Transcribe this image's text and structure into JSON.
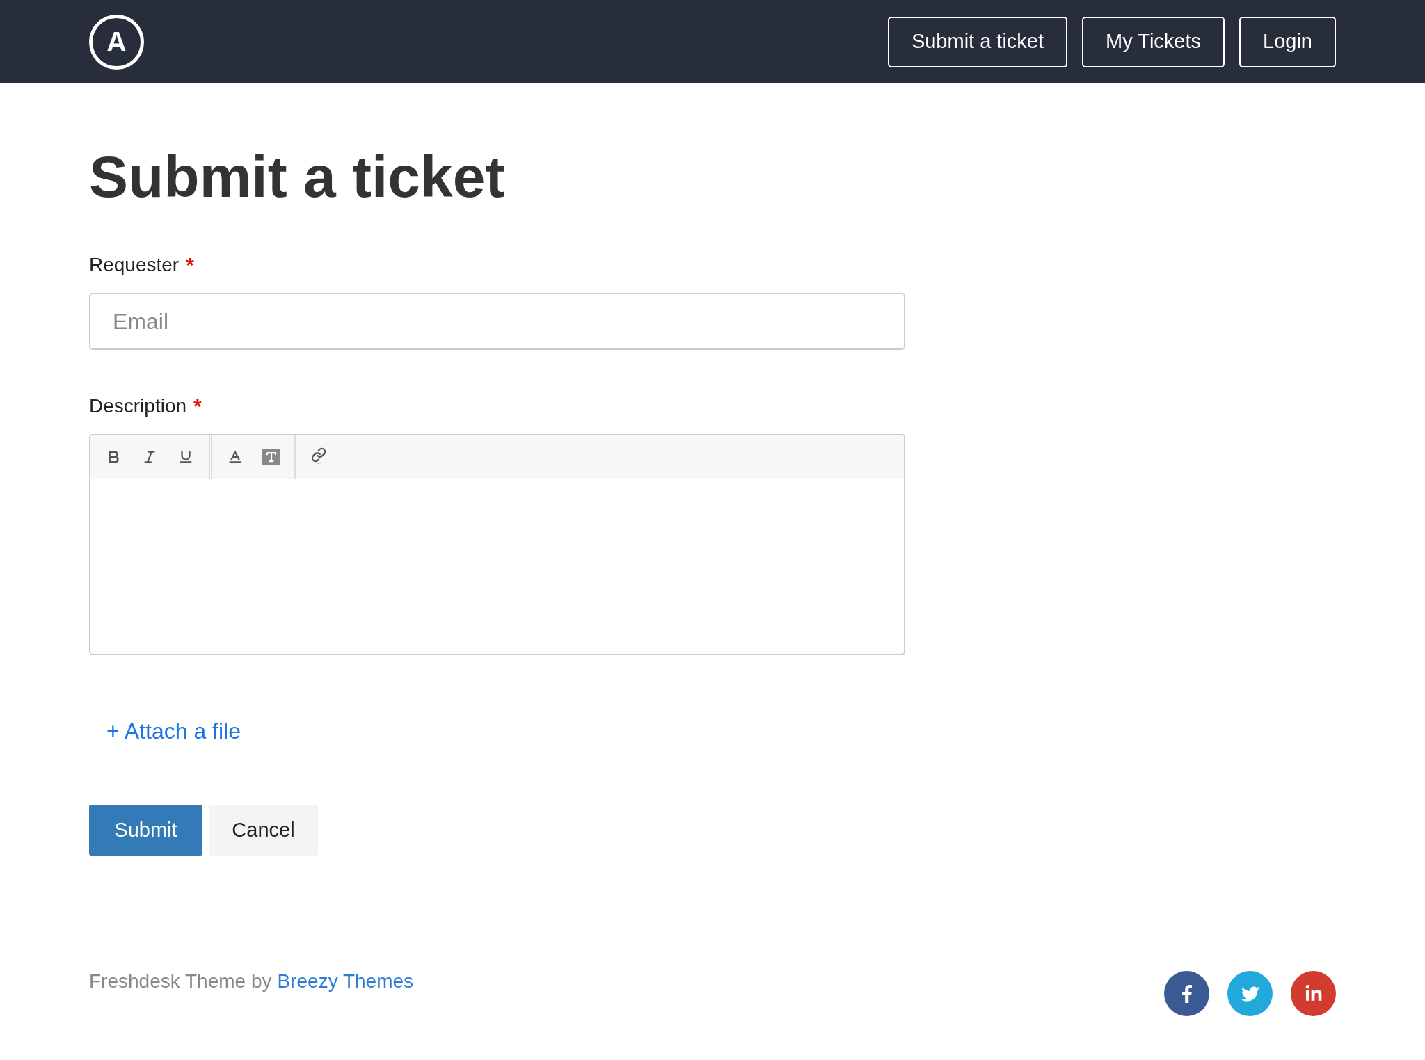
{
  "header": {
    "logo_letter": "A",
    "nav": [
      "Submit a ticket",
      "My Tickets",
      "Login"
    ]
  },
  "title": "Submit a ticket",
  "requester": {
    "label": "Requester",
    "required_mark": "*",
    "placeholder": "Email"
  },
  "description": {
    "label": "Description",
    "required_mark": "*",
    "toolbar": [
      {
        "buttons": [
          {
            "kind": "bold"
          },
          {
            "kind": "italic"
          },
          {
            "kind": "underline"
          }
        ]
      },
      {
        "buttons": [
          {
            "kind": "text-color"
          },
          {
            "kind": "background-color"
          }
        ]
      },
      {
        "buttons": [
          {
            "kind": "link"
          }
        ]
      }
    ]
  },
  "attach_link": "+ Attach a file",
  "buttons": {
    "submit": "Submit",
    "cancel": "Cancel"
  },
  "footer": {
    "text": "Freshdesk Theme by",
    "link": "Breezy Themes",
    "social": [
      {
        "kind": "facebook",
        "color": "#3b5a93"
      },
      {
        "kind": "twitter",
        "color": "#22a9dc"
      },
      {
        "kind": "linkedin",
        "color": "#d23c2e"
      }
    ]
  }
}
